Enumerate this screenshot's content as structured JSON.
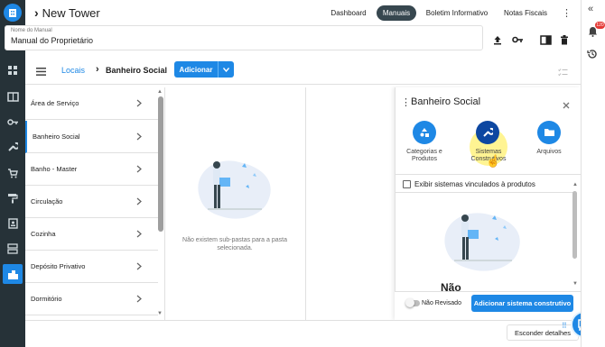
{
  "header": {
    "project_title": "New Tower",
    "nav": [
      {
        "label": "Dashboard",
        "active": false
      },
      {
        "label": "Manuais",
        "active": true
      },
      {
        "label": "Boletim Informativo",
        "active": false
      },
      {
        "label": "Notas Fiscais",
        "active": false
      }
    ]
  },
  "manual_field": {
    "label": "Nome do Manual",
    "value": "Manual do Proprietário"
  },
  "breadcrumb": {
    "root": "Locais",
    "current": "Banheiro Social"
  },
  "add_button": "Adicionar",
  "locations": [
    "Área de Serviço",
    "Banheiro Social",
    "Banho - Master",
    "Circulação",
    "Cozinha",
    "Depósito Privativo",
    "Dormitório"
  ],
  "selected_location": "Banheiro Social",
  "empty_subfolders": "Não existem sub-pastas para a pasta selecionada.",
  "detail": {
    "title": "Banheiro Social",
    "actions": [
      {
        "label": "Categorias e Produtos",
        "icon": "category-icon"
      },
      {
        "label": "Sistemas Construtivos",
        "icon": "wrench-icon"
      },
      {
        "label": "Arquivos",
        "icon": "folder-icon"
      }
    ],
    "checkbox_label": "Exibir sistemas vinculados à produtos",
    "empty_partial": "Não",
    "toggle_label": "Não Revisado",
    "add_system_button": "Adicionar sistema construtivo"
  },
  "footer": {
    "hide_details": "Esconder detalhes"
  },
  "notifications_badge": "120",
  "colors": {
    "primary": "#1e88e5",
    "rail": "#263238",
    "active_nav": "#37474f"
  }
}
